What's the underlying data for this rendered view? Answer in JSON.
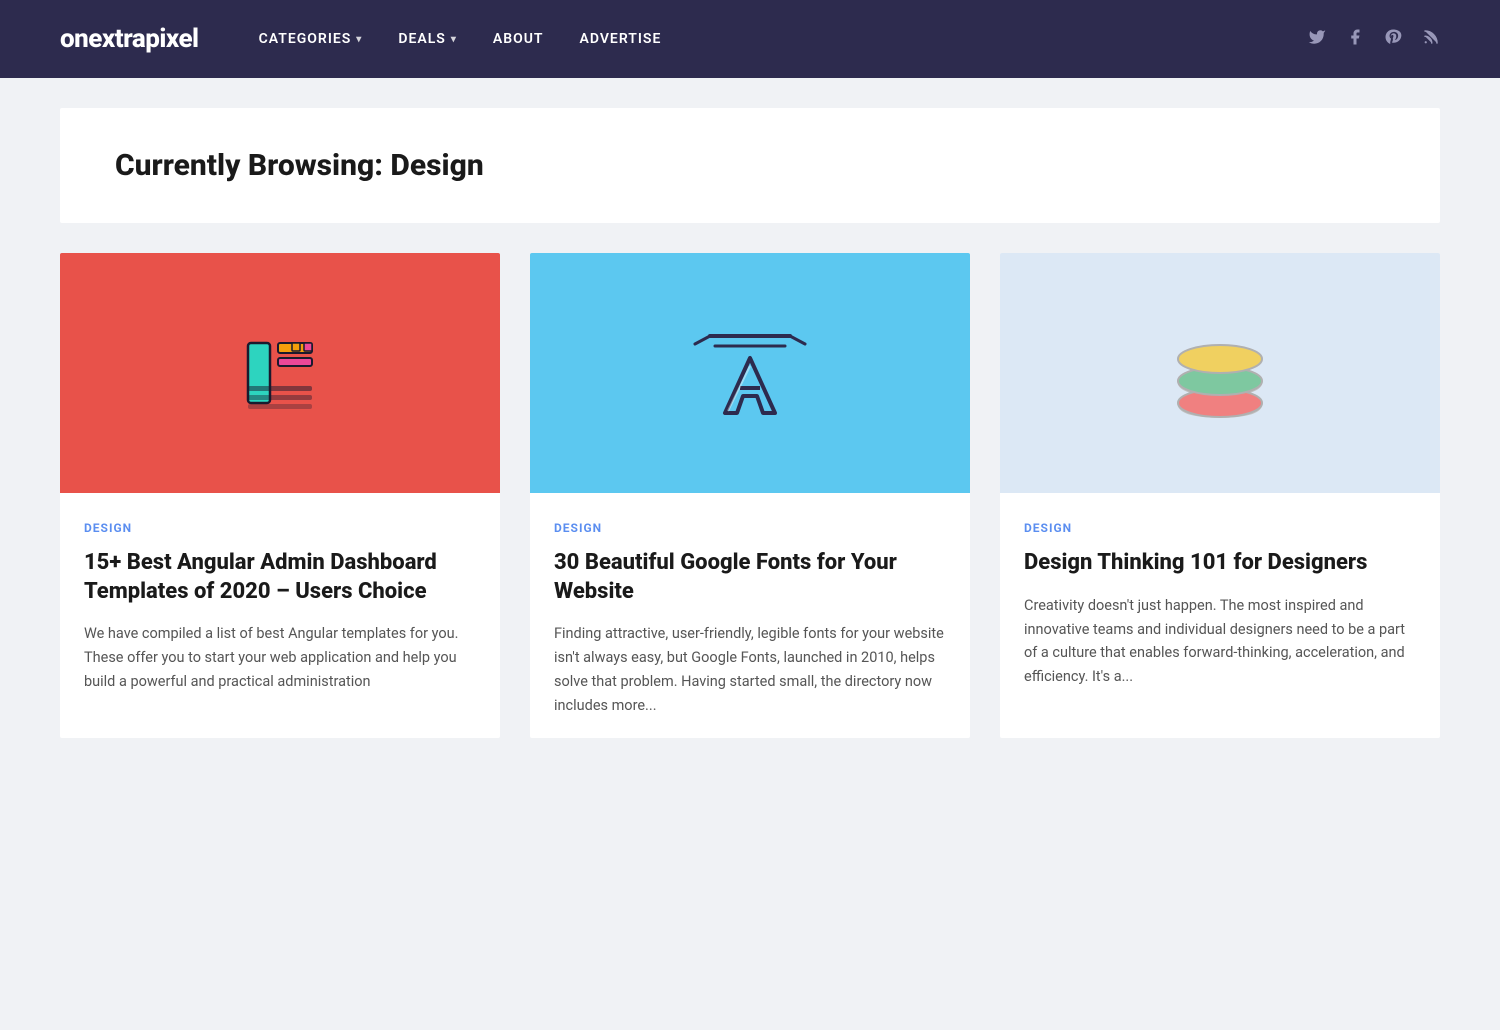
{
  "site": {
    "logo": "onextrapixel"
  },
  "nav": {
    "items": [
      {
        "label": "CATEGORIES",
        "has_dropdown": true
      },
      {
        "label": "DEALS",
        "has_dropdown": true
      },
      {
        "label": "ABOUT",
        "has_dropdown": false
      },
      {
        "label": "ADVERTISE",
        "has_dropdown": false
      }
    ],
    "social": [
      {
        "name": "twitter",
        "symbol": "𝕏"
      },
      {
        "name": "facebook",
        "symbol": "f"
      },
      {
        "name": "pinterest",
        "symbol": "P"
      },
      {
        "name": "rss",
        "symbol": "⌘"
      }
    ]
  },
  "hero": {
    "prefix": "Currently Browsing:",
    "category": "Design",
    "full_title": "Currently Browsing: Design"
  },
  "cards": [
    {
      "category": "DESIGN",
      "title": "15+ Best Angular Admin Dashboard Templates of 2020 – Users Choice",
      "excerpt": "We have compiled a list of best Angular templates for you. These offer you to start your web application and help you build a powerful and practical administration",
      "image_bg": "red",
      "image_type": "dashboard"
    },
    {
      "category": "DESIGN",
      "title": "30 Beautiful Google Fonts for Your Website",
      "excerpt": "Finding attractive, user-friendly, legible fonts for your website isn't always easy, but Google Fonts, launched in 2010, helps solve that problem. Having started small, the directory now includes more...",
      "image_bg": "blue",
      "image_type": "font"
    },
    {
      "category": "DESIGN",
      "title": "Design Thinking 101 for Designers",
      "excerpt": "Creativity doesn't just happen. The most inspired and innovative teams and individual designers need to be a part of a culture that enables forward-thinking, acceleration, and efficiency. It's a...",
      "image_bg": "light",
      "image_type": "layers"
    }
  ]
}
